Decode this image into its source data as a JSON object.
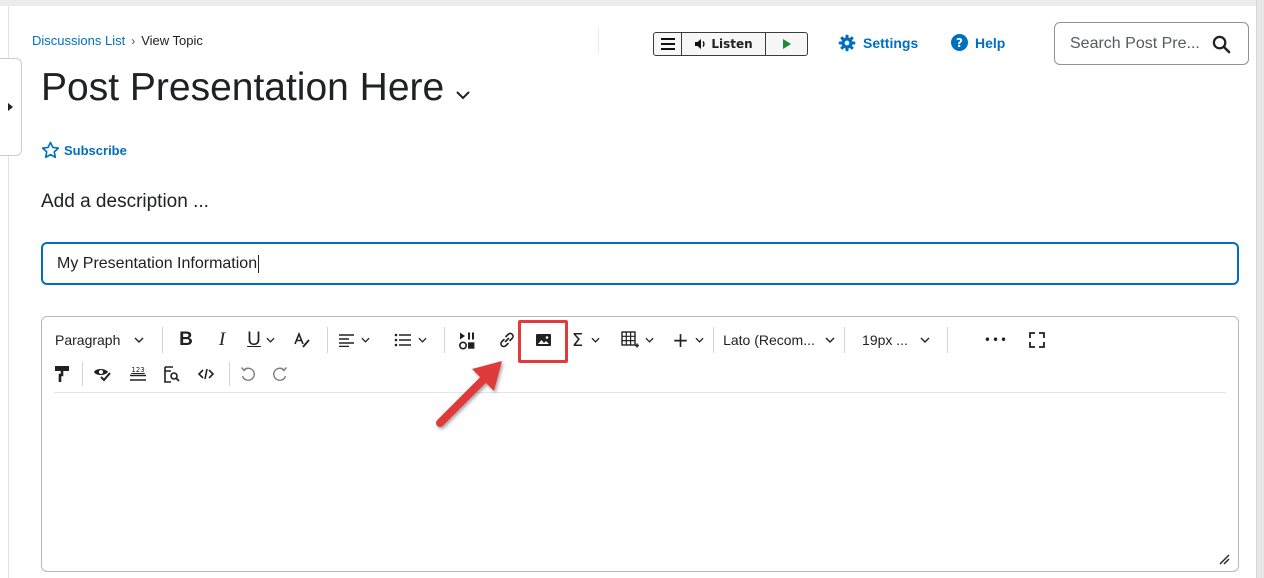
{
  "breadcrumb": {
    "parent": "Discussions List",
    "separator": "›",
    "current": "View Topic"
  },
  "listen_widget": {
    "label": "Listen"
  },
  "topnav": {
    "settings": "Settings",
    "help": "Help"
  },
  "search": {
    "placeholder": "Search Post Pre..."
  },
  "topic": {
    "title": "Post Presentation Here",
    "subscribe": "Subscribe",
    "description_placeholder": "Add a description ..."
  },
  "name_field": {
    "value": "My Presentation Information"
  },
  "editor_toolbar": {
    "format_select": "Paragraph",
    "bold": "B",
    "italic": "I",
    "underline": "U",
    "font_select": "Lato (Recom...",
    "size_select": "19px ...",
    "more": "•••",
    "word_count": "123"
  },
  "colors": {
    "accent": "#006fbf",
    "highlight": "#e03a3a",
    "text": "#202122"
  }
}
